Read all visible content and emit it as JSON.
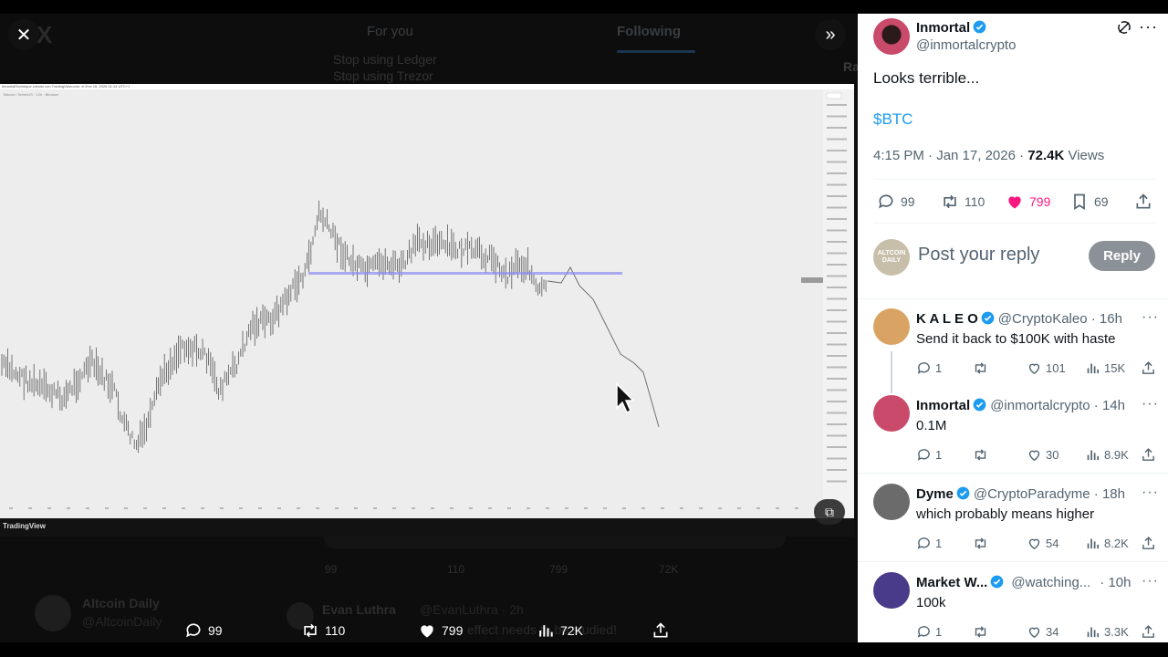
{
  "background_feed": {
    "tabs": [
      "For you",
      "Following"
    ],
    "lines": [
      "Stop using Ledger",
      "Stop using Trezor"
    ],
    "right_fragment": "Ra",
    "post_counts": [
      "99",
      "110",
      "799",
      "72K"
    ],
    "author1": {
      "name": "Altcoin Daily",
      "handle": "@AltcoinDaily"
    },
    "author2": {
      "name": "Evan Luthra",
      "handle": "@EvanLuthra · 2h",
      "text": "effect needs to be studied!"
    }
  },
  "media": {
    "chart_meta": "InmortalTechnique creado con TradingView.com, el Ene 18, 2026 01:14 UTC+1",
    "chart_symbol": "Bitcoin / TetherUS · 12h · Binance",
    "currency_label": "USDT",
    "price_tag": "95,000.00",
    "tv_brand": "TradingView",
    "actions": {
      "replies": "99",
      "reposts": "110",
      "likes": "799",
      "views": "72K"
    }
  },
  "tweet": {
    "author_name": "Inmortal",
    "author_handle": "@inmortalcrypto",
    "text": "Looks terrible...",
    "cashtag": "$BTC",
    "time": "4:15 PM · Jan 17, 2026 · ",
    "views_count": "72.4K",
    "views_label": " Views",
    "stats": {
      "replies": "99",
      "reposts": "110",
      "likes": "799",
      "bookmarks": "69"
    },
    "reply_placeholder": "Post your reply",
    "reply_button": "Reply",
    "reply_avatar_text": "ALTCOIN DAILY"
  },
  "replies": [
    {
      "name": "K A L E O",
      "handle": "@CryptoKaleo · 16h",
      "text": "Send it back to $100K with haste",
      "replies": "1",
      "likes": "101",
      "views": "15K",
      "avatar_color": "#d9a463"
    },
    {
      "name": "Inmortal",
      "handle": "@inmortalcrypto · 14h",
      "text": "0.1M",
      "replies": "1",
      "likes": "30",
      "views": "8.9K",
      "avatar_color": "#c94a6a"
    },
    {
      "name": "Dyme",
      "handle": "@CryptoParadyme · 18h",
      "text": "which probably means higher",
      "replies": "1",
      "likes": "54",
      "views": "8.2K",
      "avatar_color": "#6b6b6b"
    },
    {
      "name": "Market W...",
      "handle": "@watching...",
      "time": "· 10h",
      "text": "100k",
      "replies": "1",
      "likes": "34",
      "views": "3.3K",
      "avatar_color": "#4a3a8a"
    }
  ],
  "colors": {
    "accent": "#1d9bf0",
    "like": "#f91880",
    "verified": "#1d9bf0",
    "chart_line": "#8c8cf0"
  }
}
